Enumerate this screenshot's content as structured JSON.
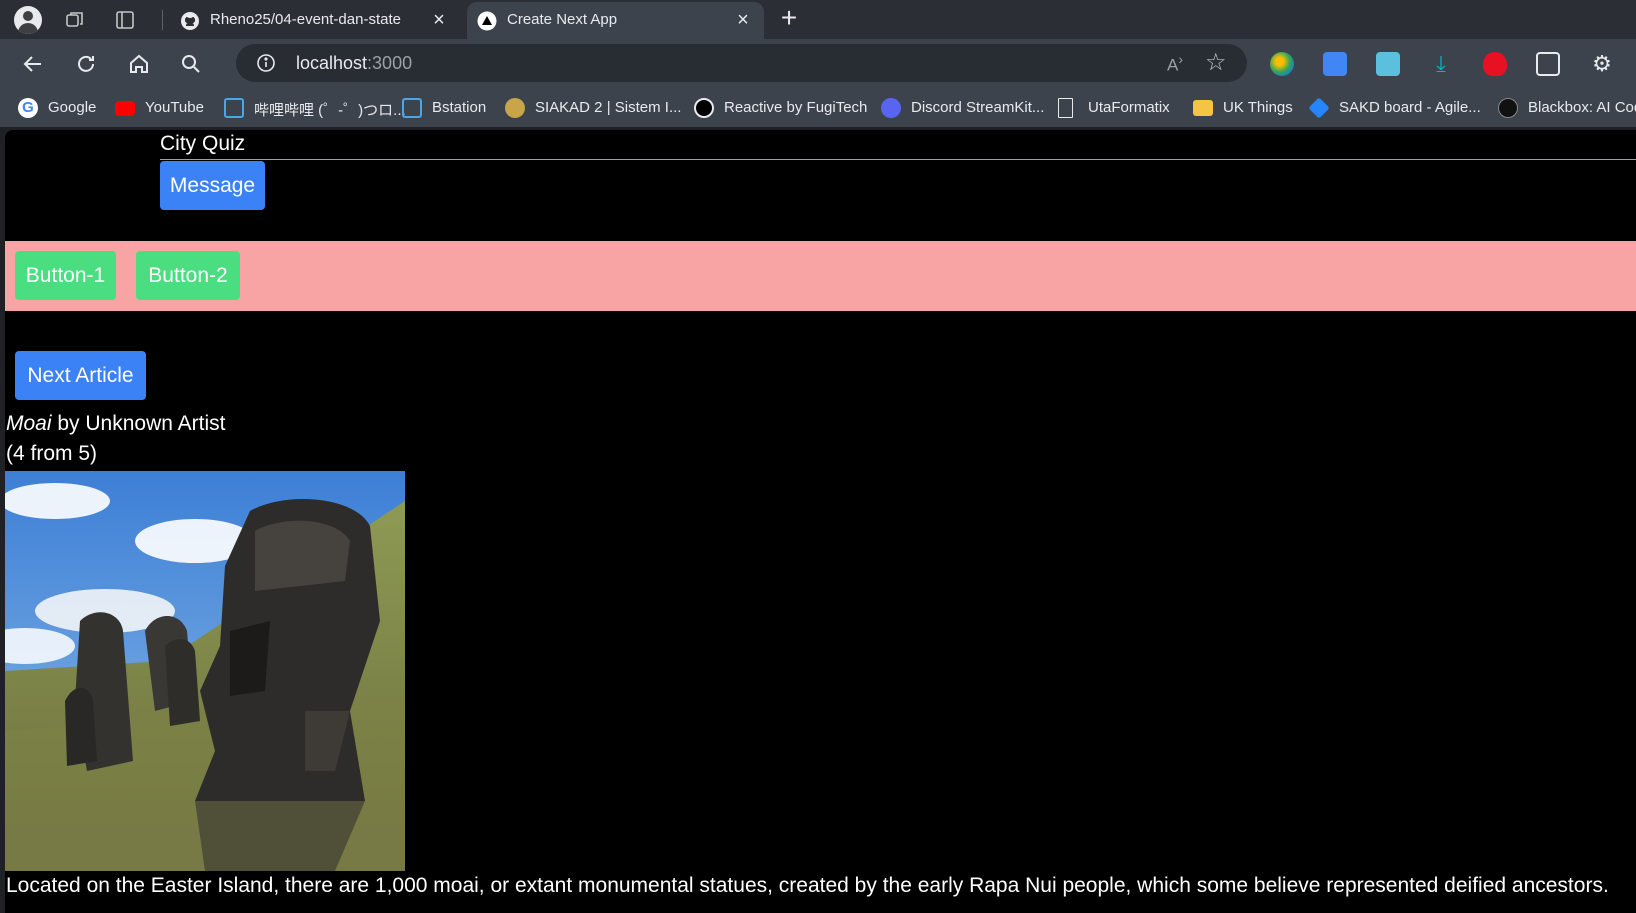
{
  "browser": {
    "tabs": [
      {
        "title": "Rheno25/04-event-dan-state",
        "favicon": "github-icon",
        "active": false
      },
      {
        "title": "Create Next App",
        "favicon": "nextjs-icon",
        "active": true
      }
    ],
    "address": {
      "host": "localhost",
      "port": ":3000"
    },
    "bookmarks": [
      {
        "label": "Google",
        "icon": "google-icon",
        "color": "#4285f4"
      },
      {
        "label": "YouTube",
        "icon": "youtube-icon",
        "color": "#ff0000"
      },
      {
        "label": "哔哩哔哩 (゜-゜)つロ...",
        "icon": "bilibili-icon",
        "color": "#4aa6e8"
      },
      {
        "label": "Bstation",
        "icon": "bstation-icon",
        "color": "#4aa6e8"
      },
      {
        "label": "SIAKAD 2 | Sistem I...",
        "icon": "siakad-icon",
        "color": "#c8a648"
      },
      {
        "label": "Reactive by FugiTech",
        "icon": "reactive-icon",
        "color": "#e8eaed"
      },
      {
        "label": "Discord StreamKit...",
        "icon": "discord-icon",
        "color": "#5865f2"
      },
      {
        "label": "UtaFormatix",
        "icon": "document-icon",
        "color": "#e8eaed"
      },
      {
        "label": "UK Things",
        "icon": "folder-icon",
        "color": "#f4c542"
      },
      {
        "label": "SAKD board - Agile...",
        "icon": "jira-icon",
        "color": "#2684ff"
      },
      {
        "label": "Blackbox: AI Cod",
        "icon": "blackbox-icon",
        "color": "#222222"
      }
    ],
    "extensions": [
      {
        "name": "google-earth-icon",
        "color": "#34a853"
      },
      {
        "name": "google-translate-icon",
        "color": "#4285f4"
      },
      {
        "name": "screenshot-icon",
        "color": "#5bc0de"
      },
      {
        "name": "download-icon",
        "color": "#00b7c3"
      },
      {
        "name": "ublock-icon",
        "color": "#e81123"
      },
      {
        "name": "window-icon",
        "color": "#e8eaed"
      },
      {
        "name": "extensions-puzzle-icon",
        "color": "#e8eaed"
      }
    ]
  },
  "page": {
    "quiz_title": "City Quiz",
    "message_button": "Message",
    "buttons": [
      "Button-1",
      "Button-2"
    ],
    "next_button": "Next Article",
    "artwork": {
      "name": "Moai",
      "by": " by Unknown Artist"
    },
    "counter": "(4 from 5)",
    "description": "Located on the Easter Island, there are 1,000 moai, or extant monumental statues, created by the early Rapa Nui people, which some believe represented deified ancestors.",
    "colors": {
      "blue_button": "#3b82f6",
      "green_button": "#4ade80",
      "band": "#f8a4a4",
      "background": "#000000"
    }
  }
}
